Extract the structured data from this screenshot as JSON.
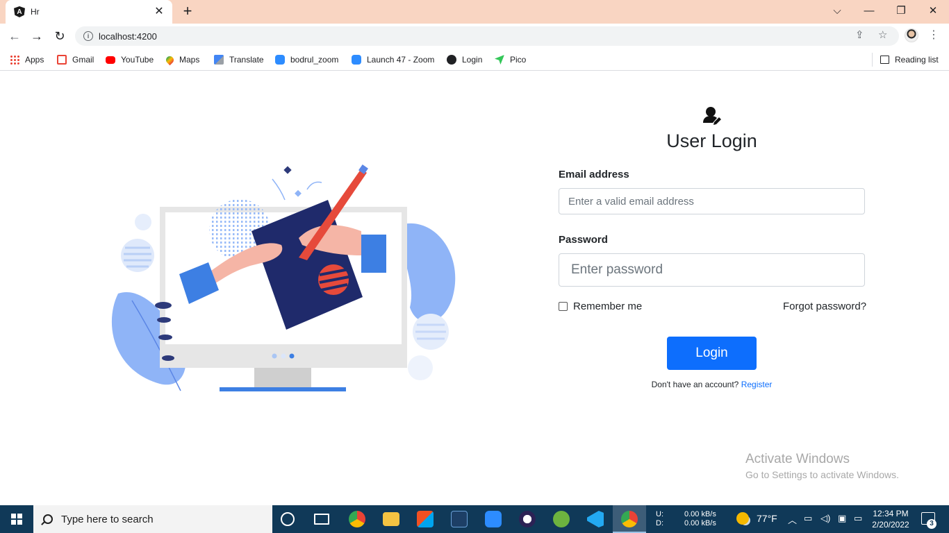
{
  "browser": {
    "tab_title": "Hr",
    "url": "localhost:4200",
    "bookmarks": [
      "Apps",
      "Gmail",
      "YouTube",
      "Maps",
      "Translate",
      "bodrul_zoom",
      "Launch 47 - Zoom",
      "Login",
      "Pico"
    ],
    "reading_list": "Reading list"
  },
  "login": {
    "title": "User Login",
    "email_label": "Email address",
    "email_placeholder": "Enter a valid email address",
    "password_label": "Password",
    "password_placeholder": "Enter password",
    "remember_label": "Remember me",
    "forgot_label": "Forgot password?",
    "submit_label": "Login",
    "register_prompt": "Don't have an account?",
    "register_link": "Register",
    "accent_color": "#0d6efd"
  },
  "watermark": {
    "line1": "Activate Windows",
    "line2": "Go to Settings to activate Windows."
  },
  "taskbar": {
    "search_placeholder": "Type here to search",
    "net_up_label": "U:",
    "net_down_label": "D:",
    "net_up_value": "0.00 kB/s",
    "net_down_value": "0.00 kB/s",
    "temperature": "77°F",
    "time": "12:34 PM",
    "date": "2/20/2022",
    "notification_count": "3"
  }
}
